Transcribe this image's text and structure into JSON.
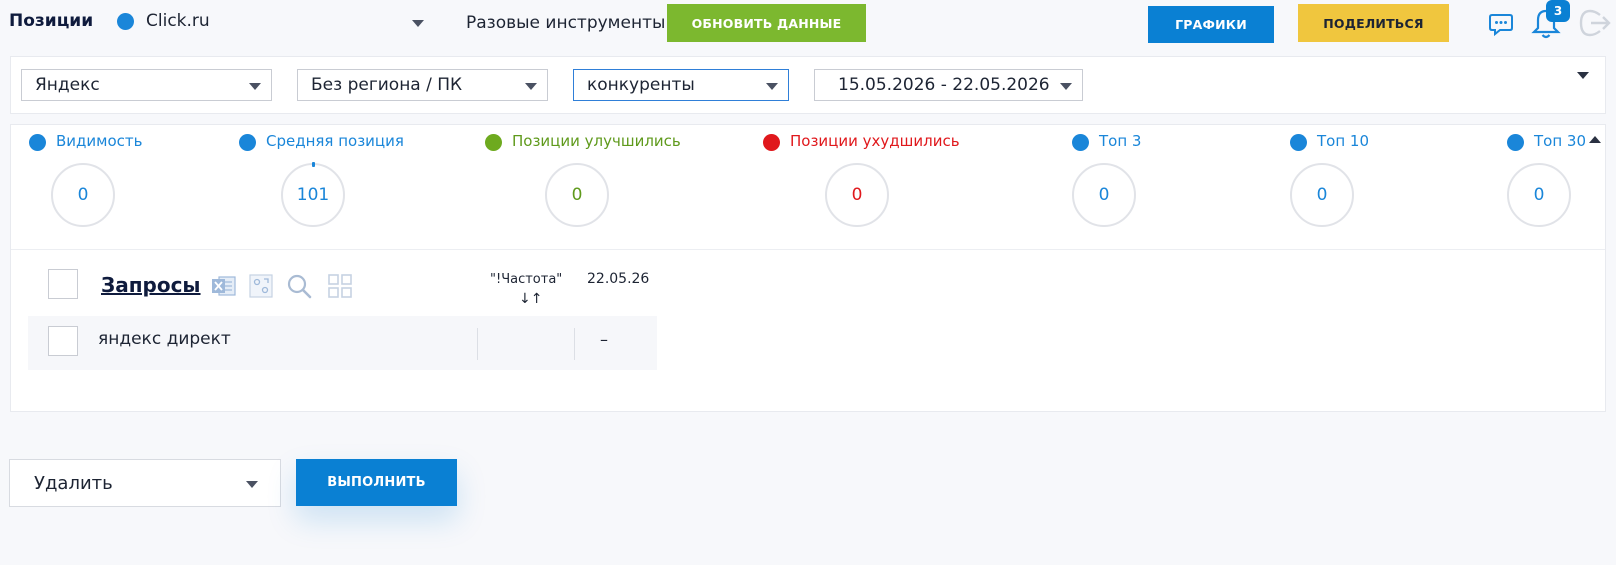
{
  "header": {
    "title": "Позиции",
    "project_name": "Click.ru",
    "tools_label": "Разовые инструменты",
    "refresh_label": "ОБНОВИТЬ ДАННЫЕ",
    "charts_label": "ГРАФИКИ",
    "share_label": "ПОДЕЛИТЬСЯ",
    "notifications_count": "3"
  },
  "filters": {
    "engine": "Яндекс",
    "region": "Без региона / ПК",
    "compare": "конкуренты",
    "date_range": "15.05.2026 - 22.05.2026"
  },
  "metrics": [
    {
      "label": "Видимость",
      "value": "0",
      "color": "#1a86d9"
    },
    {
      "label": "Средняя позиция",
      "value": "101",
      "color": "#1a86d9"
    },
    {
      "label": "Позиции улучшились",
      "value": "0",
      "color": "#6eaa1f"
    },
    {
      "label": "Позиции ухудшились",
      "value": "0",
      "color": "#e0181c"
    },
    {
      "label": "Топ 3",
      "value": "0",
      "color": "#1a86d9"
    },
    {
      "label": "Топ 10",
      "value": "0",
      "color": "#1a86d9"
    },
    {
      "label": "Топ 30",
      "value": "0",
      "color": "#1a86d9"
    }
  ],
  "table": {
    "title": "Запросы",
    "frequency_header": "\"!Частота\"",
    "sort_glyph": "↓↑",
    "date_header": "22.05.26",
    "rows": [
      {
        "keyword": "яндекс директ",
        "frequency": "",
        "position": "–"
      }
    ]
  },
  "actions": {
    "selected_action": "Удалить",
    "run_label": "ВЫПОЛНИТЬ"
  },
  "colors": {
    "accent_blue": "#0a80d3",
    "accent_green": "#7cb82f",
    "accent_yellow": "#f0c63e",
    "danger_red": "#e0181c"
  }
}
